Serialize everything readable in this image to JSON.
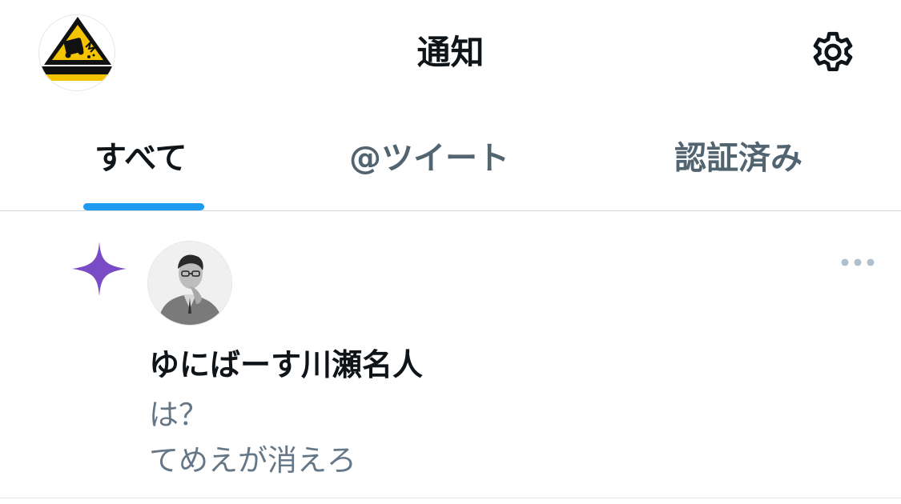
{
  "header": {
    "title": "通知",
    "avatar_icon": "caution-sign-avatar-icon",
    "settings_icon": "gear-icon"
  },
  "tabs": [
    {
      "label": "すべて",
      "selected": true
    },
    {
      "label": "@ツイート",
      "selected": false
    },
    {
      "label": "認証済み",
      "selected": false
    }
  ],
  "notification": {
    "type_icon": "sparkle-icon",
    "user_name": "ゆにばーす川瀬名人",
    "text": "は？\nてめえが消えろ",
    "more_icon": "more-dots-icon"
  },
  "colors": {
    "accent": "#1d9bf0",
    "text_primary": "#0f1419",
    "text_secondary": "#536471",
    "tweet_text": "#657786",
    "sparkle": "#794bc4",
    "divider": "#cfd9de"
  }
}
